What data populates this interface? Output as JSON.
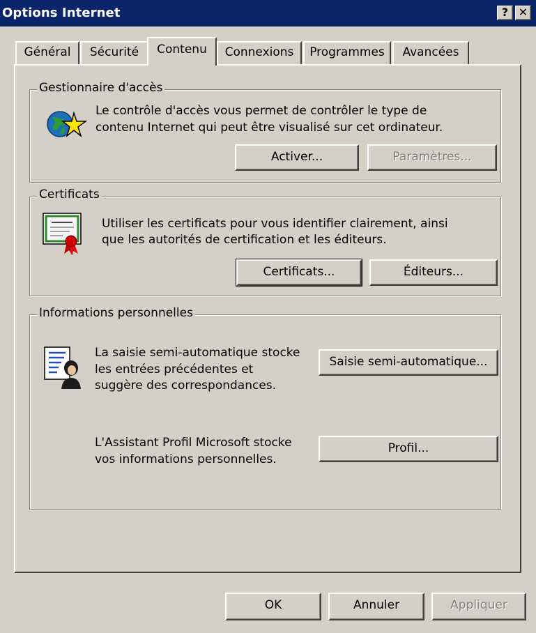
{
  "window": {
    "title": "Options Internet",
    "help_glyph": "?",
    "close_glyph": "✕"
  },
  "tabs": [
    {
      "label": "Général"
    },
    {
      "label": "Sécurité"
    },
    {
      "label": "Contenu"
    },
    {
      "label": "Connexions"
    },
    {
      "label": "Programmes"
    },
    {
      "label": "Avancées"
    }
  ],
  "active_tab": "Contenu",
  "content_advisor": {
    "legend": "Gestionnaire d'accès",
    "desc_line1": "Le contrôle d'accès vous permet de contrôler le type de",
    "desc_line2": "contenu Internet qui peut être visualisé sur cet ordinateur.",
    "enable_label": "Activer...",
    "settings_label": "Paramètres...",
    "icon": "globe-star-icon"
  },
  "certificates": {
    "legend": "Certificats",
    "desc_line1": "Utiliser les certificats pour vous identifier clairement, ainsi",
    "desc_line2": "que les autorités de certification et les éditeurs.",
    "certificates_label": "Certificats...",
    "publishers_label": "Éditeurs...",
    "icon": "certificate-icon"
  },
  "personal_info": {
    "legend": "Informations personnelles",
    "autocomplete_line1": "La saisie semi-automatique stocke",
    "autocomplete_line2": "les entrées précédentes et",
    "autocomplete_line3": "suggère des correspondances.",
    "autocomplete_label": "Saisie semi-automatique...",
    "profile_line1": "L'Assistant Profil Microsoft stocke",
    "profile_line2": "vos informations personnelles.",
    "profile_label": "Profil...",
    "icon": "profile-document-icon"
  },
  "footer": {
    "ok_label": "OK",
    "cancel_label": "Annuler",
    "apply_label": "Appliquer"
  },
  "colors": {
    "titlebar": "#0a246a",
    "face": "#d4d0c8",
    "disabled_text": "#808080"
  }
}
